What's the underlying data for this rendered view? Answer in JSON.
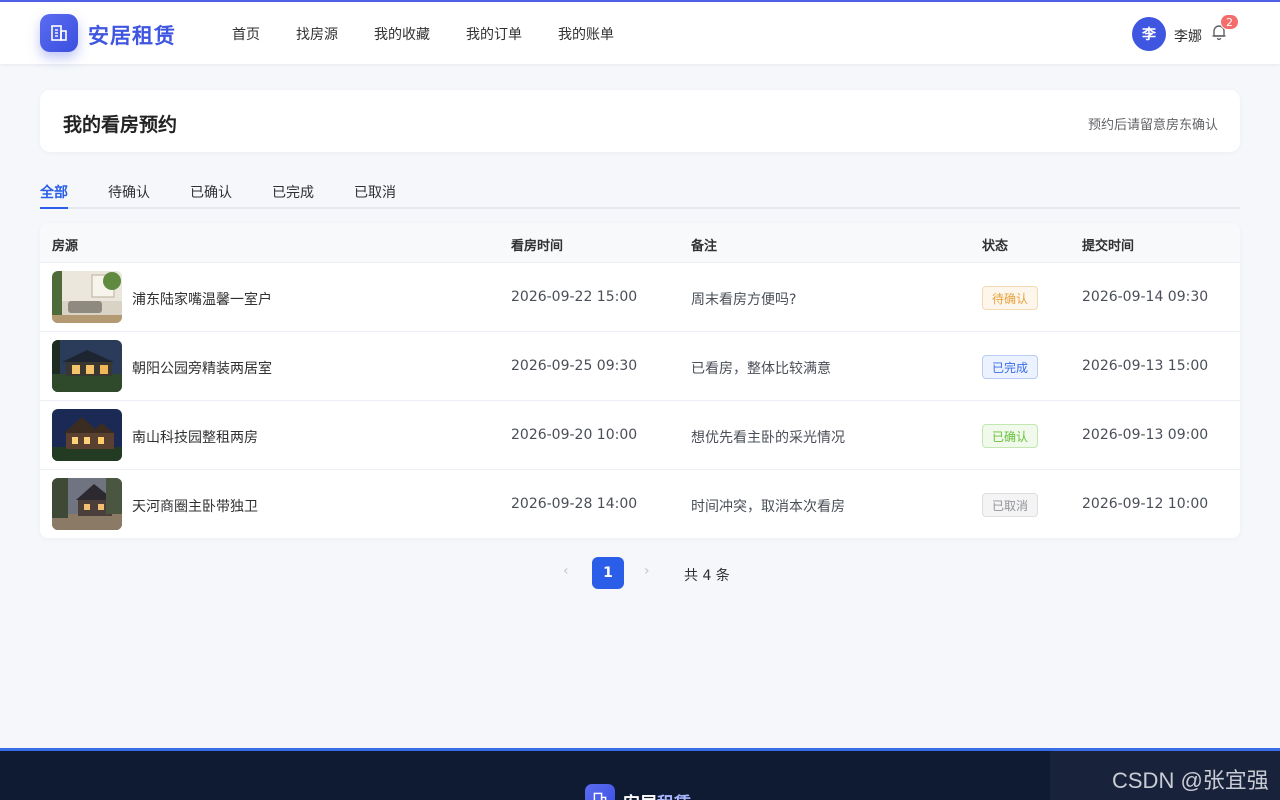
{
  "brand": {
    "name": "安居租赁",
    "name_part1": "安居",
    "name_part2": "租赁"
  },
  "nav": {
    "items": [
      {
        "label": "首页"
      },
      {
        "label": "找房源"
      },
      {
        "label": "我的收藏"
      },
      {
        "label": "我的订单"
      },
      {
        "label": "我的账单"
      }
    ]
  },
  "user": {
    "avatar_initial": "李",
    "name": "李娜",
    "notification_count": "2"
  },
  "header": {
    "title": "我的看房预约",
    "hint": "预约后请留意房东确认"
  },
  "tabs": [
    {
      "label": "全部",
      "active": true
    },
    {
      "label": "待确认"
    },
    {
      "label": "已确认"
    },
    {
      "label": "已完成"
    },
    {
      "label": "已取消"
    }
  ],
  "table": {
    "columns": [
      "房源",
      "看房时间",
      "备注",
      "状态",
      "提交时间"
    ],
    "rows": [
      {
        "title": "浦东陆家嘴温馨一室户",
        "visit_time": "2026-09-22 15:00",
        "note": "周末看房方便吗?",
        "status": "待确认",
        "submitted": "2026-09-14 09:30",
        "status_color": "#e6a23c",
        "status_bg": "#fdf6ec",
        "status_border": "#f5dab1"
      },
      {
        "title": "朝阳公园旁精装两居室",
        "visit_time": "2026-09-25 09:30",
        "note": "已看房，整体比较满意",
        "status": "已完成",
        "submitted": "2026-09-13 15:00",
        "status_color": "#3a6ee8",
        "status_bg": "#ecf2ff",
        "status_border": "#b8ccf7"
      },
      {
        "title": "南山科技园整租两房",
        "visit_time": "2026-09-20 10:00",
        "note": "想优先看主卧的采光情况",
        "status": "已确认",
        "submitted": "2026-09-13 09:00",
        "status_color": "#67c23a",
        "status_bg": "#f0f9eb",
        "status_border": "#c2e7b0"
      },
      {
        "title": "天河商圈主卧带独卫",
        "visit_time": "2026-09-28 14:00",
        "note": "时间冲突，取消本次看房",
        "status": "已取消",
        "submitted": "2026-09-12 10:00",
        "status_color": "#909399",
        "status_bg": "#f4f4f5",
        "status_border": "#dcdee2"
      }
    ]
  },
  "pagination": {
    "current": "1",
    "total_text": "共 4 条"
  },
  "watermark": "CSDN @张宜强",
  "colors": {
    "accent": "#2a5ee8",
    "brand": "#3f56e0",
    "footer": "#0f1a33"
  }
}
